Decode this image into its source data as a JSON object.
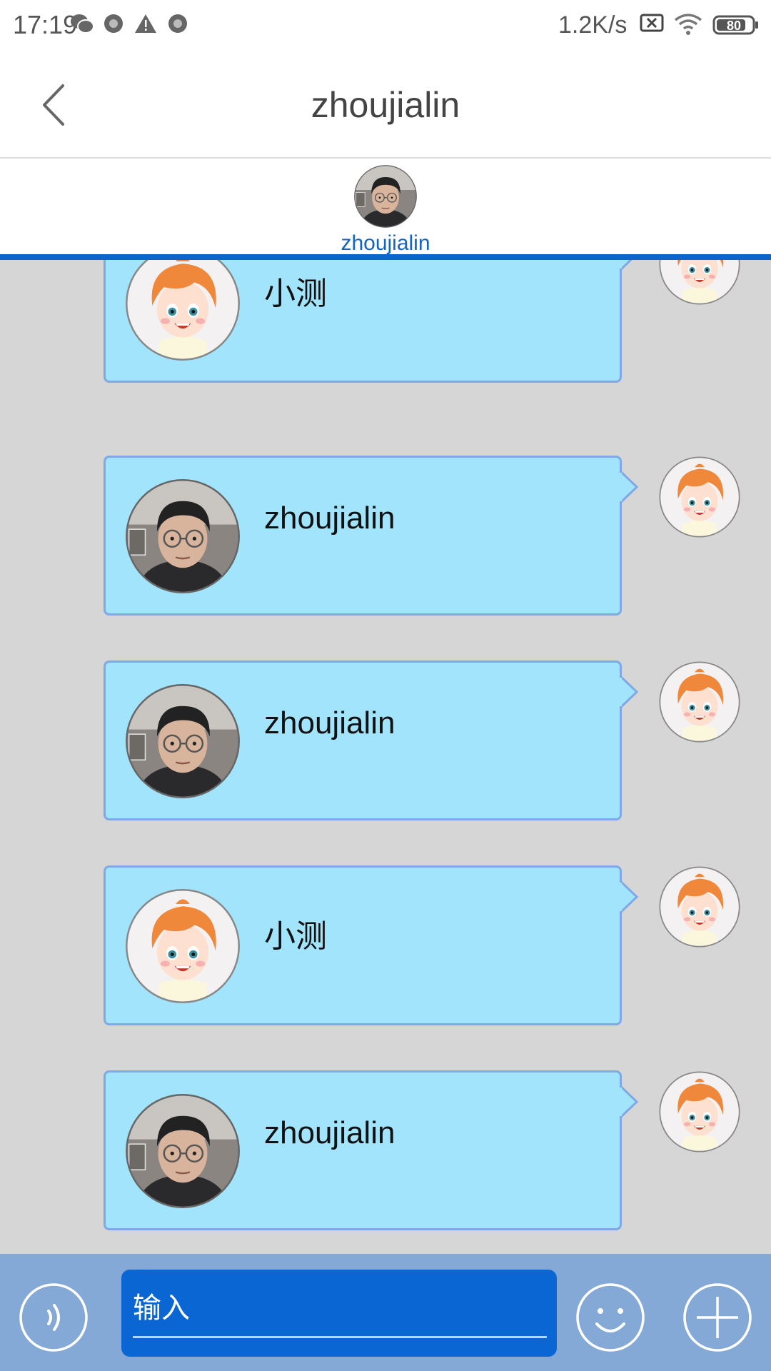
{
  "status_bar": {
    "time": "17:19",
    "network_speed": "1.2K/s",
    "battery_level": "80",
    "icons": [
      "wechat-icon",
      "circle-notification-icon",
      "warning-icon",
      "circle-notification-icon",
      "sim-x-icon",
      "wifi-icon",
      "battery-icon"
    ]
  },
  "header": {
    "title": "zhoujialin"
  },
  "participants": [
    {
      "name": "zhoujialin",
      "avatar": "man-photo"
    }
  ],
  "messages": [
    {
      "text": "小测",
      "inner_avatar": "cartoon-girl",
      "side_avatar": "cartoon-girl"
    },
    {
      "text": "zhoujialin",
      "inner_avatar": "man-photo",
      "side_avatar": "cartoon-girl"
    },
    {
      "text": "zhoujialin",
      "inner_avatar": "man-photo",
      "side_avatar": "cartoon-girl"
    },
    {
      "text": "小测",
      "inner_avatar": "cartoon-girl",
      "side_avatar": "cartoon-girl"
    },
    {
      "text": "zhoujialin",
      "inner_avatar": "man-photo",
      "side_avatar": "cartoon-girl"
    }
  ],
  "input_bar": {
    "placeholder": "输入",
    "buttons": [
      "voice-icon",
      "emoji-icon",
      "plus-icon"
    ]
  },
  "colors": {
    "accent": "#0a66cc",
    "bubble_bg": "#a1e4fc",
    "bubble_border": "#7fa8e6",
    "chat_bg": "#d6d6d6",
    "input_bar_bg": "#84a9d7",
    "input_field_bg": "#0a66d2"
  }
}
